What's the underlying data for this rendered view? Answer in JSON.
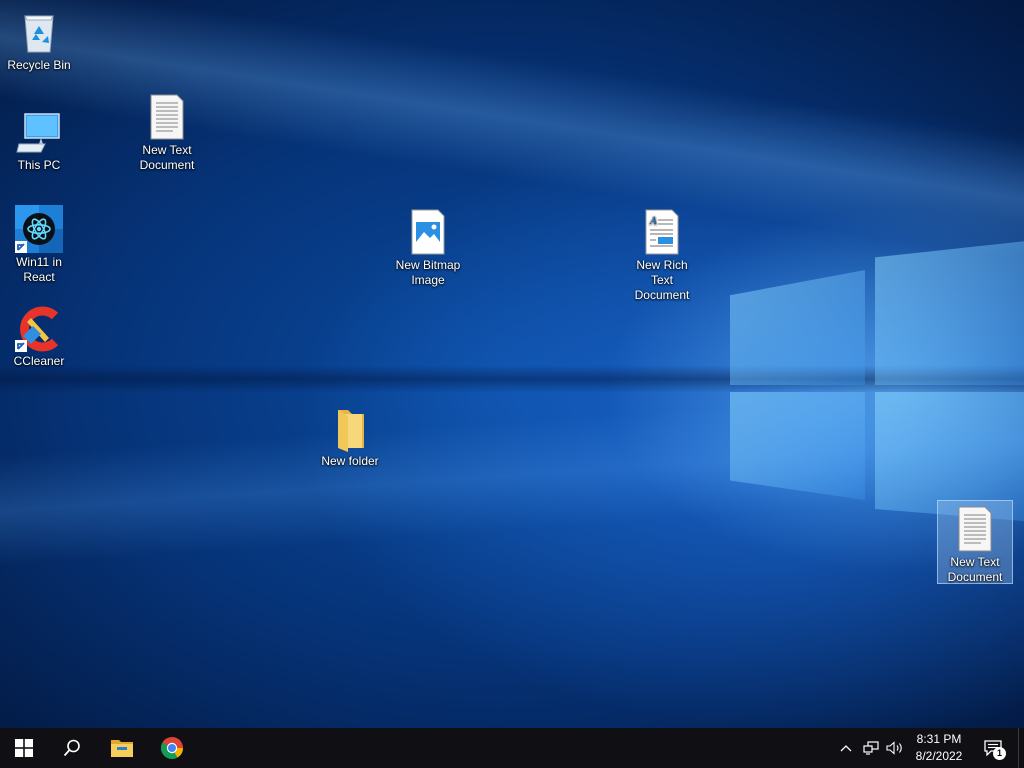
{
  "desktop": {
    "icons": [
      {
        "label": "Recycle Bin",
        "icon": "recycle-bin-icon"
      },
      {
        "label": "This PC",
        "icon": "computer-icon"
      },
      {
        "label": "Win11 in React",
        "icon": "react-app-icon"
      },
      {
        "label": "CCleaner",
        "icon": "ccleaner-icon"
      },
      {
        "label": "New Text Document",
        "icon": "text-document-icon"
      },
      {
        "label": "New Bitmap Image",
        "icon": "bitmap-image-icon"
      },
      {
        "label": "New Rich Text Document",
        "icon": "rich-text-document-icon"
      },
      {
        "label": "New folder",
        "icon": "folder-icon"
      },
      {
        "label": "New Text Document",
        "icon": "text-document-icon",
        "selected": true
      }
    ]
  },
  "taskbar": {
    "start": "start-button",
    "search": "search-button",
    "pinned": [
      "File Explorer",
      "Google Chrome"
    ],
    "clock": {
      "time": "8:31 PM",
      "date": "8/2/2022"
    },
    "notifications_count": "1"
  },
  "colors": {
    "taskbar_bg": "#101014",
    "desktop_blue": "#063378",
    "start_logo": "#ffffff"
  }
}
